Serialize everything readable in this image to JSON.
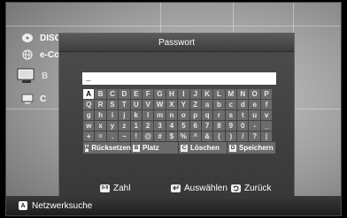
{
  "sidebar": {
    "items": [
      {
        "label": "DISC",
        "icon": "disc-icon"
      },
      {
        "label": "e-Co",
        "icon": "globe-icon"
      },
      {
        "label": "B",
        "icon": "monitor-icon"
      },
      {
        "label": "C",
        "icon": "display-icon"
      }
    ]
  },
  "dialog": {
    "title": "Passwort",
    "password_value": "_",
    "keyboard_rows": [
      [
        "A",
        "B",
        "C",
        "D",
        "E",
        "F",
        "G",
        "H",
        "I",
        "J",
        "K",
        "L",
        "M",
        "N",
        "O",
        "P"
      ],
      [
        "Q",
        "R",
        "S",
        "T",
        "U",
        "V",
        "W",
        "X",
        "Y",
        "Z",
        "a",
        "b",
        "c",
        "d",
        "e",
        "f"
      ],
      [
        "g",
        "h",
        "i",
        "j",
        "k",
        "l",
        "m",
        "n",
        "o",
        "p",
        "q",
        "r",
        "s",
        "t",
        "u",
        "v"
      ],
      [
        "w",
        "x",
        "y",
        "z",
        "1",
        "2",
        "3",
        "4",
        "5",
        "6",
        "7",
        "8",
        "9",
        "0",
        "-",
        "_"
      ],
      [
        "+",
        "=",
        ".",
        "~",
        "!",
        "@",
        "#",
        "$",
        "%",
        "^",
        "&",
        "(",
        ")",
        "/",
        "?",
        "|"
      ]
    ],
    "selected_key": "A",
    "function_keys": [
      {
        "badge": "A",
        "label": "Rücksetzen"
      },
      {
        "badge": "B",
        "label": "Platz"
      },
      {
        "badge": "C",
        "label": "Löschen"
      },
      {
        "badge": "D",
        "label": "Speichern"
      }
    ],
    "footer": {
      "number_label": "Zahl",
      "number_badge": "0-9",
      "select_label": "Auswählen",
      "back_label": "Zurück"
    }
  },
  "bottom_bar": {
    "badge": "A",
    "label": "Netzwerksuche"
  }
}
